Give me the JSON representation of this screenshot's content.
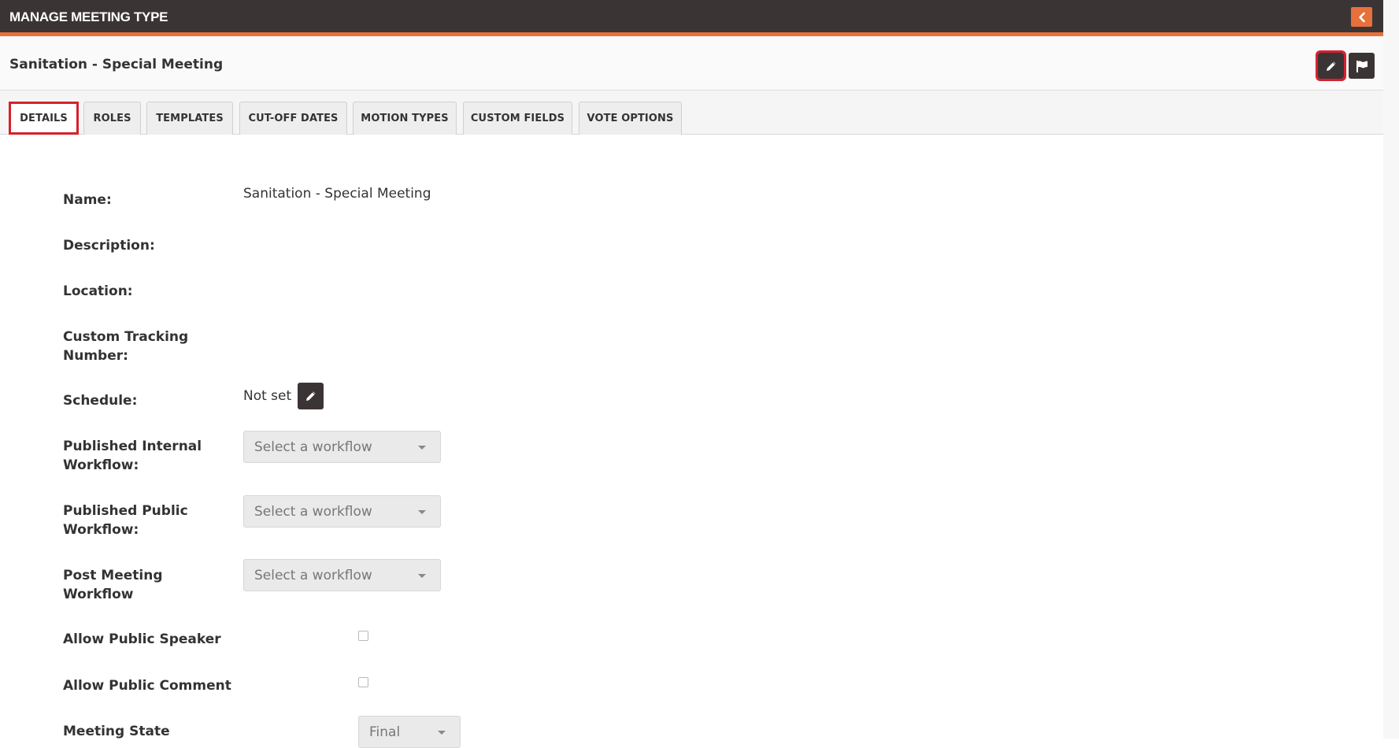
{
  "topbar": {
    "title": "MANAGE MEETING TYPE",
    "collapse_icon": "chevron-left-icon"
  },
  "header": {
    "title": "Sanitation - Special Meeting",
    "edit_icon": "pencil-icon",
    "flag_icon": "flag-icon"
  },
  "tabs": [
    {
      "label": "DETAILS",
      "active": true
    },
    {
      "label": "ROLES"
    },
    {
      "label": "TEMPLATES"
    },
    {
      "label": "CUT-OFF DATES"
    },
    {
      "label": "MOTION TYPES"
    },
    {
      "label": "CUSTOM FIELDS"
    },
    {
      "label": "VOTE OPTIONS"
    }
  ],
  "form": {
    "name_label": "Name:",
    "name_value": "Sanitation - Special Meeting",
    "description_label": "Description:",
    "location_label": "Location:",
    "tracking_label_1": "Custom Tracking",
    "tracking_label_2": "Number:",
    "schedule_label": "Schedule:",
    "schedule_value": "Not set",
    "internal_label_1": "Published Internal",
    "internal_label_2": "Workflow:",
    "internal_value": "Select a workflow",
    "public_label_1": "Published Public",
    "public_label_2": "Workflow:",
    "public_value": "Select a workflow",
    "post_label_1": "Post Meeting",
    "post_label_2": "Workflow",
    "post_value": "Select a workflow",
    "speaker_label": "Allow Public Speaker",
    "speaker_checked": false,
    "comment_label": "Allow Public Comment",
    "comment_checked": false,
    "state_label": "Meeting State",
    "state_value": "Final"
  },
  "colors": {
    "topbar_bg": "#3b3435",
    "accent": "#e8703a",
    "highlight": "#d6212e"
  }
}
